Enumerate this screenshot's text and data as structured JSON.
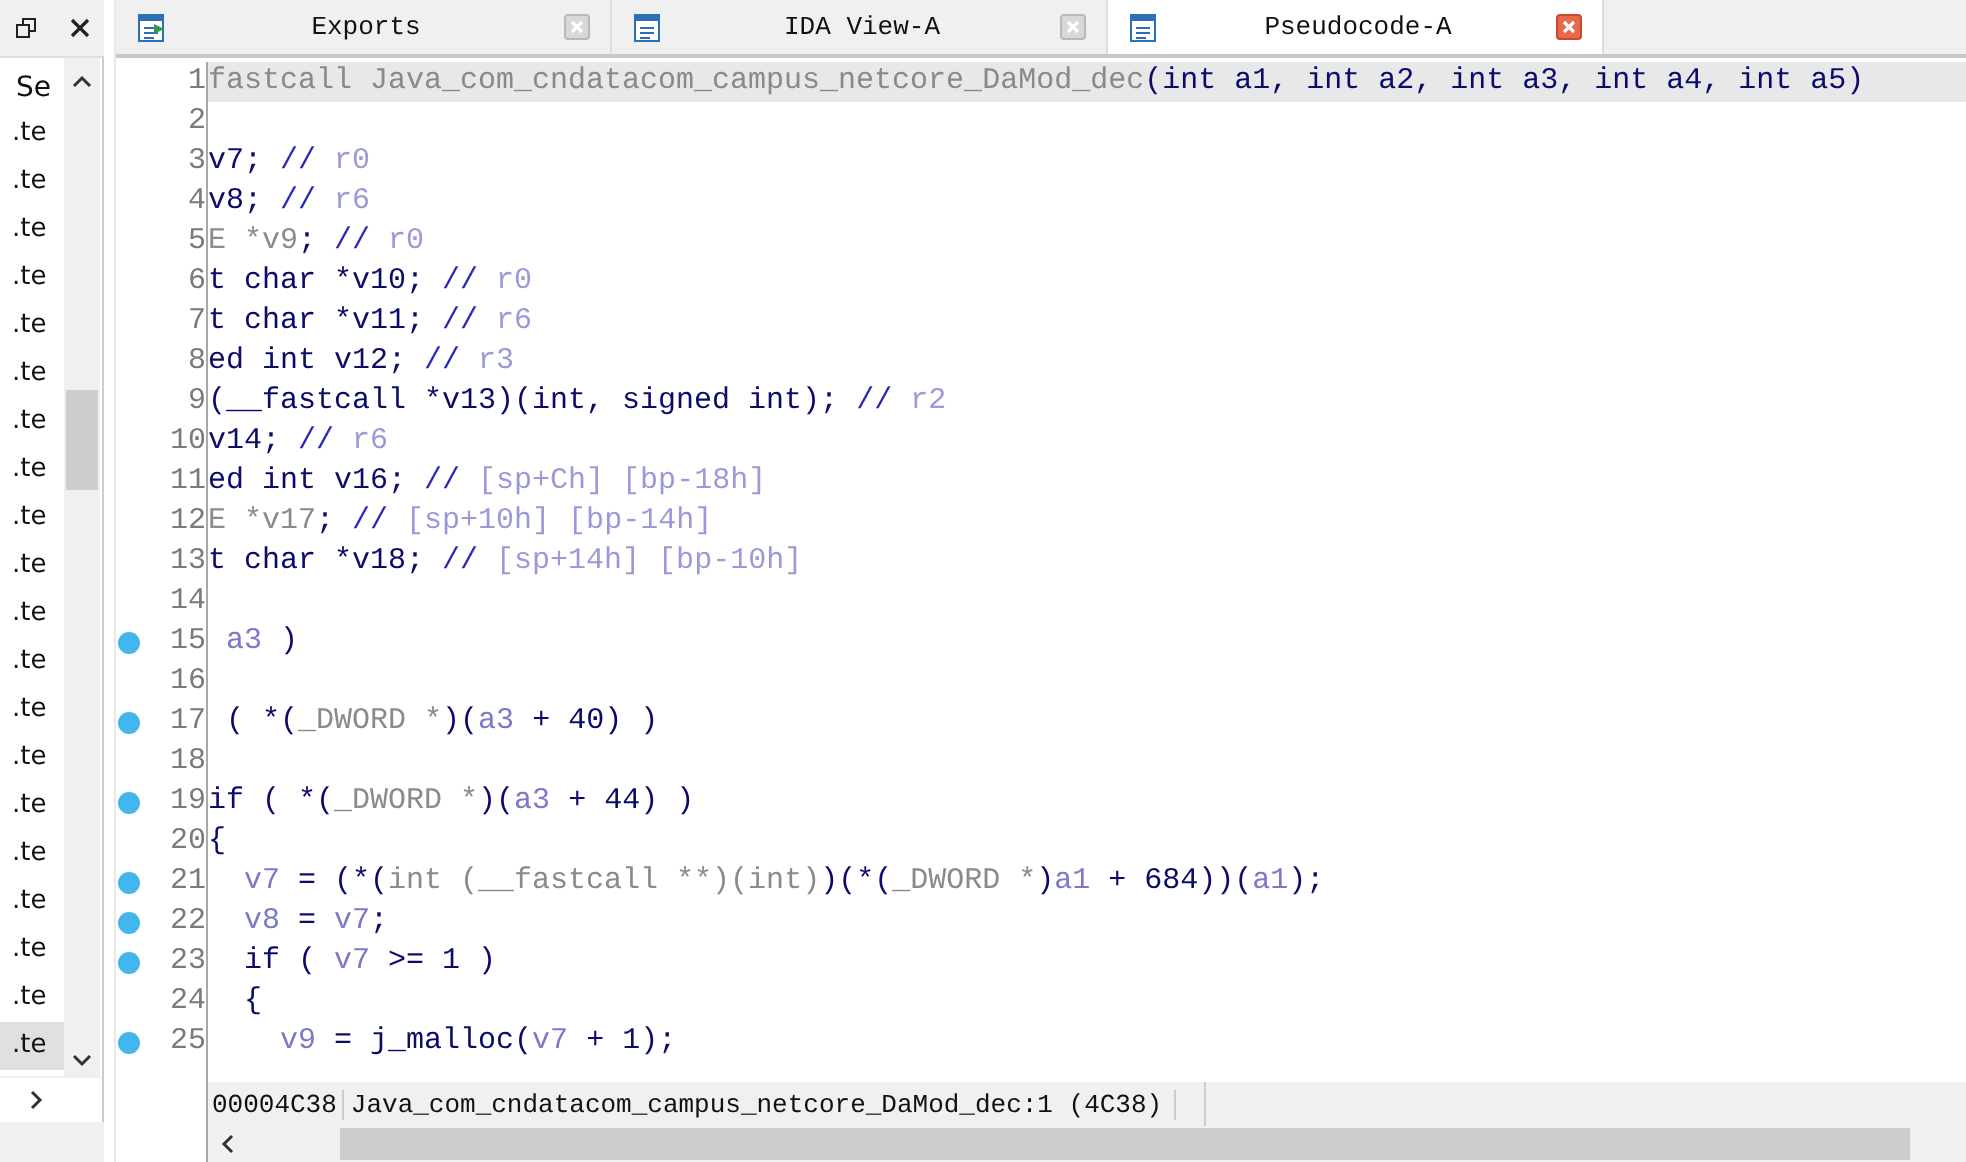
{
  "side_panel": {
    "header": "Se",
    "items": [
      {
        "label": ".te",
        "selected": false
      },
      {
        "label": ".te",
        "selected": false
      },
      {
        "label": ".te",
        "selected": false
      },
      {
        "label": ".te",
        "selected": false
      },
      {
        "label": ".te",
        "selected": false
      },
      {
        "label": ".te",
        "selected": false
      },
      {
        "label": ".te",
        "selected": false
      },
      {
        "label": ".te",
        "selected": false
      },
      {
        "label": ".te",
        "selected": false
      },
      {
        "label": ".te",
        "selected": false
      },
      {
        "label": ".te",
        "selected": false
      },
      {
        "label": ".te",
        "selected": false
      },
      {
        "label": ".te",
        "selected": false
      },
      {
        "label": ".te",
        "selected": false
      },
      {
        "label": ".te",
        "selected": false
      },
      {
        "label": ".te",
        "selected": false
      },
      {
        "label": ".te",
        "selected": false
      },
      {
        "label": ".te",
        "selected": false
      },
      {
        "label": ".te",
        "selected": false
      },
      {
        "label": ".te",
        "selected": true
      }
    ]
  },
  "tabs": [
    {
      "label": "Exports",
      "selected": false
    },
    {
      "label": "IDA View-A",
      "selected": false
    },
    {
      "label": "Pseudocode-A",
      "selected": true
    }
  ],
  "code_lines": [
    {
      "number": "1",
      "breakpoint": false,
      "highlighted": true,
      "tokens": [
        {
          "kind": "g",
          "text": "fastcall Java_com_cndatacom_campus_netcore_DaMod_dec"
        },
        {
          "kind": "n",
          "text": "(int a1, int a2, int a3, int a4, int a5)"
        }
      ]
    },
    {
      "number": "2",
      "breakpoint": false,
      "highlighted": false
    },
    {
      "number": "3",
      "breakpoint": false,
      "highlighted": false,
      "tokens": [
        {
          "kind": "n",
          "text": "v7; "
        },
        {
          "kind": "c",
          "text": "// "
        },
        {
          "kind": "r",
          "text": "r0"
        }
      ]
    },
    {
      "number": "4",
      "breakpoint": false,
      "highlighted": false,
      "tokens": [
        {
          "kind": "n",
          "text": "v8; "
        },
        {
          "kind": "c",
          "text": "// "
        },
        {
          "kind": "r",
          "text": "r6"
        }
      ]
    },
    {
      "number": "5",
      "breakpoint": false,
      "highlighted": false,
      "tokens": [
        {
          "kind": "g",
          "text": "E *v9"
        },
        {
          "kind": "n",
          "text": "; "
        },
        {
          "kind": "c",
          "text": "// "
        },
        {
          "kind": "r",
          "text": "r0"
        }
      ]
    },
    {
      "number": "6",
      "breakpoint": false,
      "highlighted": false,
      "tokens": [
        {
          "kind": "n",
          "text": "t char *v10; "
        },
        {
          "kind": "c",
          "text": "// "
        },
        {
          "kind": "r",
          "text": "r0"
        }
      ]
    },
    {
      "number": "7",
      "breakpoint": false,
      "highlighted": false,
      "tokens": [
        {
          "kind": "n",
          "text": "t char *v11; "
        },
        {
          "kind": "c",
          "text": "// "
        },
        {
          "kind": "r",
          "text": "r6"
        }
      ]
    },
    {
      "number": "8",
      "breakpoint": false,
      "highlighted": false,
      "tokens": [
        {
          "kind": "n",
          "text": "ed int v12; "
        },
        {
          "kind": "c",
          "text": "// "
        },
        {
          "kind": "r",
          "text": "r3"
        }
      ]
    },
    {
      "number": "9",
      "breakpoint": false,
      "highlighted": false,
      "tokens": [
        {
          "kind": "n",
          "text": "(__fastcall *v13)(int, signed int); "
        },
        {
          "kind": "c",
          "text": "// "
        },
        {
          "kind": "r",
          "text": "r2"
        }
      ]
    },
    {
      "number": "10",
      "breakpoint": false,
      "highlighted": false,
      "tokens": [
        {
          "kind": "n",
          "text": "v14; "
        },
        {
          "kind": "c",
          "text": "// "
        },
        {
          "kind": "r",
          "text": "r6"
        }
      ]
    },
    {
      "number": "11",
      "breakpoint": false,
      "highlighted": false,
      "tokens": [
        {
          "kind": "n",
          "text": "ed int v16; "
        },
        {
          "kind": "c",
          "text": "// "
        },
        {
          "kind": "r",
          "text": "[sp+Ch] [bp-18h]"
        }
      ]
    },
    {
      "number": "12",
      "breakpoint": false,
      "highlighted": false,
      "tokens": [
        {
          "kind": "g",
          "text": "E *v17"
        },
        {
          "kind": "n",
          "text": "; "
        },
        {
          "kind": "c",
          "text": "// "
        },
        {
          "kind": "r",
          "text": "[sp+10h] [bp-14h]"
        }
      ]
    },
    {
      "number": "13",
      "breakpoint": false,
      "highlighted": false,
      "tokens": [
        {
          "kind": "n",
          "text": "t char *v18; "
        },
        {
          "kind": "c",
          "text": "// "
        },
        {
          "kind": "r",
          "text": "[sp+14h] [bp-10h]"
        }
      ]
    },
    {
      "number": "14",
      "breakpoint": false,
      "highlighted": false
    },
    {
      "number": "15",
      "breakpoint": true,
      "highlighted": false,
      "tokens": [
        {
          "kind": "v",
          "text": " a3"
        },
        {
          "kind": "n",
          "text": " )"
        }
      ]
    },
    {
      "number": "16",
      "breakpoint": false,
      "highlighted": false
    },
    {
      "number": "17",
      "breakpoint": true,
      "highlighted": false,
      "tokens": [
        {
          "kind": "n",
          "text": " ( *("
        },
        {
          "kind": "g",
          "text": "_DWORD *"
        },
        {
          "kind": "n",
          "text": ")("
        },
        {
          "kind": "v",
          "text": "a3"
        },
        {
          "kind": "n",
          "text": " + 40) )"
        }
      ]
    },
    {
      "number": "18",
      "breakpoint": false,
      "highlighted": false
    },
    {
      "number": "19",
      "breakpoint": true,
      "highlighted": false,
      "tokens": [
        {
          "kind": "n",
          "text": "if ( *("
        },
        {
          "kind": "g",
          "text": "_DWORD *"
        },
        {
          "kind": "n",
          "text": ")("
        },
        {
          "kind": "v",
          "text": "a3"
        },
        {
          "kind": "n",
          "text": " + 44) )"
        }
      ]
    },
    {
      "number": "20",
      "breakpoint": false,
      "highlighted": false,
      "tokens": [
        {
          "kind": "n",
          "text": "{"
        }
      ]
    },
    {
      "number": "21",
      "breakpoint": true,
      "highlighted": false,
      "tokens": [
        {
          "kind": "v",
          "text": "  v7"
        },
        {
          "kind": "n",
          "text": " = (*("
        },
        {
          "kind": "g",
          "text": "int (__fastcall **)(int)"
        },
        {
          "kind": "n",
          "text": ")(*("
        },
        {
          "kind": "g",
          "text": "_DWORD *"
        },
        {
          "kind": "n",
          "text": ")"
        },
        {
          "kind": "v",
          "text": "a1"
        },
        {
          "kind": "n",
          "text": " + 684))("
        },
        {
          "kind": "v",
          "text": "a1"
        },
        {
          "kind": "n",
          "text": ");"
        }
      ]
    },
    {
      "number": "22",
      "breakpoint": true,
      "highlighted": false,
      "tokens": [
        {
          "kind": "v",
          "text": "  v8"
        },
        {
          "kind": "n",
          "text": " = "
        },
        {
          "kind": "v",
          "text": "v7"
        },
        {
          "kind": "n",
          "text": ";"
        }
      ]
    },
    {
      "number": "23",
      "breakpoint": true,
      "highlighted": false,
      "tokens": [
        {
          "kind": "n",
          "text": "  if ( "
        },
        {
          "kind": "v",
          "text": "v7"
        },
        {
          "kind": "n",
          "text": " >= 1 )"
        }
      ]
    },
    {
      "number": "24",
      "breakpoint": false,
      "highlighted": false,
      "tokens": [
        {
          "kind": "n",
          "text": "  {"
        }
      ]
    },
    {
      "number": "25",
      "breakpoint": true,
      "highlighted": false,
      "tokens": [
        {
          "kind": "v",
          "text": "    v9"
        },
        {
          "kind": "n",
          "text": " = j_malloc("
        },
        {
          "kind": "v",
          "text": "v7"
        },
        {
          "kind": "n",
          "text": " + 1);"
        }
      ]
    }
  ],
  "status_bar": {
    "address": "00004C38",
    "location": "Java_com_cndatacom_campus_netcore_DaMod_dec:1 (4C38)"
  }
}
